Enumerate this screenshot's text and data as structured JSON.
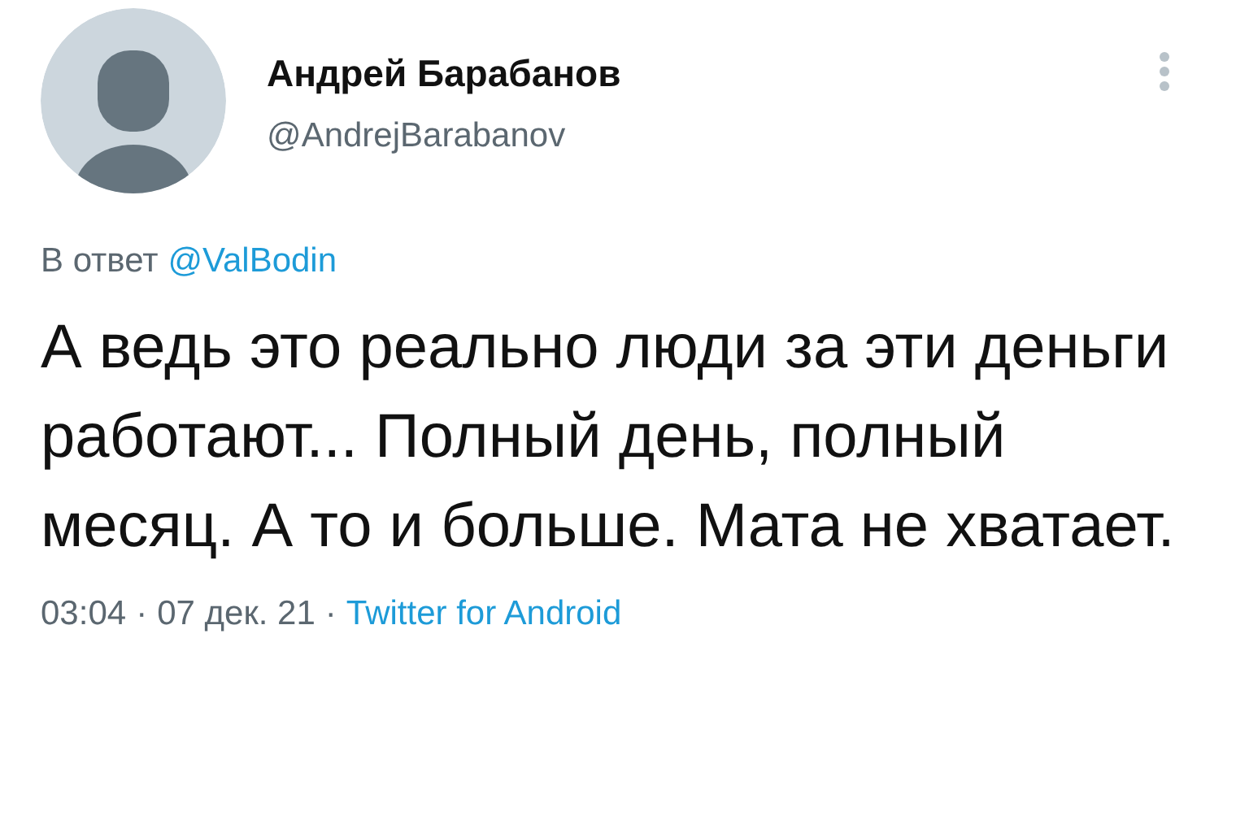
{
  "author": {
    "name": "Андрей Барабанов",
    "handle": "@AndrejBarabanov"
  },
  "reply": {
    "prefix": "В ответ",
    "mention": "@ValBodin"
  },
  "text": "А ведь это реально люди за эти деньги работают... Полный день, полный месяц. А то и больше. Мата не хватает.",
  "meta": {
    "time": "03:04",
    "separator_1": "·",
    "date": "07 дек. 21",
    "separator_2": "·",
    "source": "Twitter for Android"
  }
}
